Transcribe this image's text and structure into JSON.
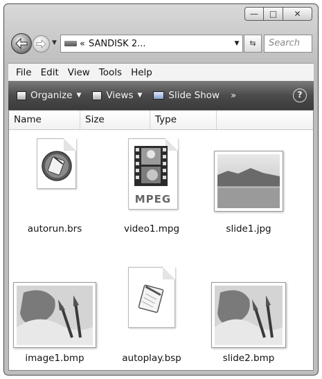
{
  "window": {
    "caption_buttons": {
      "minimize": "—",
      "maximize": "□",
      "close": "✕"
    }
  },
  "nav": {
    "address_prefix": "«",
    "address_text": "SANDISK 2...",
    "search_placeholder": "Search"
  },
  "menu": [
    "File",
    "Edit",
    "View",
    "Tools",
    "Help"
  ],
  "toolbar": {
    "organize": "Organize",
    "views": "Views",
    "slideshow": "Slide Show",
    "more": "»",
    "help": "?"
  },
  "columns": [
    "Name",
    "Size",
    "Type"
  ],
  "files": [
    {
      "name": "autorun.brs",
      "icon": "script-document-icon"
    },
    {
      "name": "video1.mpg",
      "icon": "mpeg-video-icon",
      "badge": "MPEG"
    },
    {
      "name": "slide1.jpg",
      "icon": "landscape-image-thumbnail"
    },
    {
      "name": "image1.bmp",
      "icon": "paint-bitmap-thumbnail"
    },
    {
      "name": "autoplay.bsp",
      "icon": "notepad-document-icon"
    },
    {
      "name": "slide2.bmp",
      "icon": "paint-bitmap-thumbnail"
    }
  ]
}
